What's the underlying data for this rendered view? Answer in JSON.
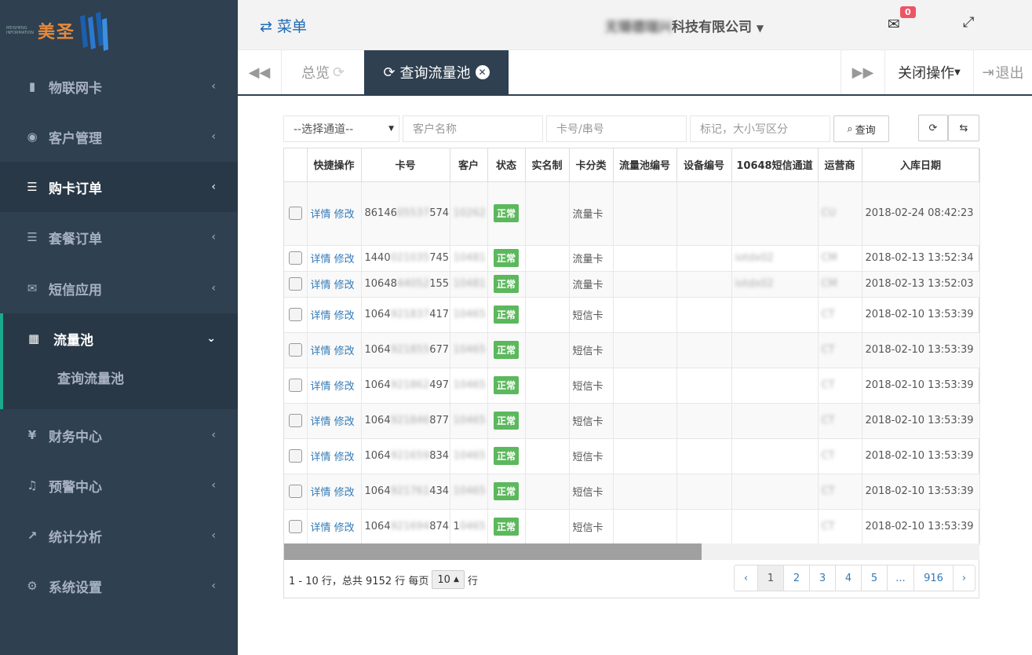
{
  "logo": {
    "brand": "美圣",
    "tagline": "MEISHENG INFORMATION"
  },
  "sidebar": {
    "items": [
      {
        "label": "物联网卡",
        "icon": "sim-card-icon"
      },
      {
        "label": "客户管理",
        "icon": "user-circle-icon"
      },
      {
        "label": "购卡订单",
        "icon": "list-icon"
      },
      {
        "label": "套餐订单",
        "icon": "list-icon"
      },
      {
        "label": "短信应用",
        "icon": "envelope-icon"
      },
      {
        "label": "流量池",
        "icon": "table-grid-icon"
      },
      {
        "label": "财务中心",
        "icon": "yen-icon"
      },
      {
        "label": "预警中心",
        "icon": "bell-icon"
      },
      {
        "label": "统计分析",
        "icon": "line-chart-icon"
      },
      {
        "label": "系统设置",
        "icon": "gear-icon"
      }
    ],
    "submenu": {
      "label": "查询流量池"
    }
  },
  "topbar": {
    "menu_label": "菜单",
    "company_prefix": "无锡德瑞兴",
    "company_suffix": "科技有限公司",
    "mail_count": "0"
  },
  "tabs": {
    "home": "总览",
    "active": "查询流量池",
    "close_ops": "关闭操作",
    "logout": "退出"
  },
  "filters": {
    "channel": "--选择通道--",
    "customer_placeholder": "客户名称",
    "card_placeholder": "卡号/串号",
    "tag_placeholder": "标记，大小写区分",
    "query_label": "查询"
  },
  "table": {
    "columns": [
      "快捷操作",
      "卡号",
      "客户",
      "状态",
      "实名制",
      "卡分类",
      "流量池编号",
      "设备编号",
      "10648短信通道",
      "运营商",
      "入库日期"
    ],
    "detail_label": "详情",
    "edit_label": "修改",
    "rows": [
      {
        "card_a": "86146",
        "card_b": "05537",
        "card_c": "574",
        "cust_a": "",
        "cust_b": "10262",
        "status": "正常",
        "type": "流量卡",
        "sms": "",
        "carrier": "CU",
        "date": "2018-02-24 08:42:23"
      },
      {
        "card_a": "1440",
        "card_b": "021035",
        "card_c": "745",
        "cust_a": "",
        "cust_b": "10481",
        "status": "正常",
        "type": "流量卡",
        "sms": "iotdx02",
        "carrier": "CM",
        "date": "2018-02-13 13:52:34"
      },
      {
        "card_a": "10648",
        "card_b": "44052",
        "card_c": "155",
        "cust_a": "",
        "cust_b": "10481",
        "status": "正常",
        "type": "流量卡",
        "sms": "iotdx02",
        "carrier": "CM",
        "date": "2018-02-13 13:52:03"
      },
      {
        "card_a": "1064",
        "card_b": "921837",
        "card_c": "417",
        "cust_a": "",
        "cust_b": "10465",
        "status": "正常",
        "type": "短信卡",
        "sms": "",
        "carrier": "CT",
        "date": "2018-02-10 13:53:39"
      },
      {
        "card_a": "1064",
        "card_b": "921855",
        "card_c": "677",
        "cust_a": "",
        "cust_b": "10465",
        "status": "正常",
        "type": "短信卡",
        "sms": "",
        "carrier": "CT",
        "date": "2018-02-10 13:53:39"
      },
      {
        "card_a": "1064",
        "card_b": "921862",
        "card_c": "497",
        "cust_a": "",
        "cust_b": "10465",
        "status": "正常",
        "type": "短信卡",
        "sms": "",
        "carrier": "CT",
        "date": "2018-02-10 13:53:39"
      },
      {
        "card_a": "1064",
        "card_b": "921846",
        "card_c": "877",
        "cust_a": "",
        "cust_b": "10465",
        "status": "正常",
        "type": "短信卡",
        "sms": "",
        "carrier": "CT",
        "date": "2018-02-10 13:53:39"
      },
      {
        "card_a": "1064",
        "card_b": "921659",
        "card_c": "834",
        "cust_a": "",
        "cust_b": "10465",
        "status": "正常",
        "type": "短信卡",
        "sms": "",
        "carrier": "CT",
        "date": "2018-02-10 13:53:39"
      },
      {
        "card_a": "1064",
        "card_b": "921761",
        "card_c": "434",
        "cust_a": "",
        "cust_b": "10465",
        "status": "正常",
        "type": "短信卡",
        "sms": "",
        "carrier": "CT",
        "date": "2018-02-10 13:53:39"
      },
      {
        "card_a": "1064",
        "card_b": "921694",
        "card_c": "874",
        "cust_a": "1",
        "cust_b": "0465",
        "status": "正常",
        "type": "短信卡",
        "sms": "",
        "carrier": "CT",
        "date": "2018-02-10 13:53:39"
      }
    ]
  },
  "pagination": {
    "summary_pre": "1 - 10 行，总共 9152 行 每页",
    "page_size": "10",
    "summary_post": "行",
    "prev": "‹",
    "pages": [
      "1",
      "2",
      "3",
      "4",
      "5",
      "...",
      "916"
    ],
    "next": "›",
    "scroll_position": 0.6
  },
  "colors": {
    "sidebar": "#2f4050",
    "accent": "#19aa8d",
    "status_ok": "#5cb85c",
    "badge": "#ed5565",
    "link": "#337ab7"
  }
}
